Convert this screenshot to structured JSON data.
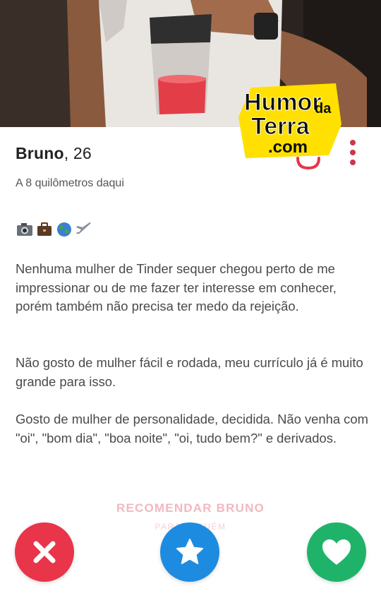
{
  "profile": {
    "name": "Bruno",
    "age": "26",
    "distance": "A 8 quilômetros daqui",
    "emojis": [
      "camera-icon",
      "briefcase-icon",
      "globe-icon",
      "airplane-icon"
    ],
    "bio": [
      "Nenhuma mulher de Tinder sequer chegou perto de me impressionar ou de me fazer ter interesse em conhecer, porém também não precisa ter medo da rejeição.",
      "Não gosto de mulher fácil e rodada, meu currículo já é muito grande para isso.",
      "Gosto de mulher de personalidade, decidida. Não venha com \"oi\", \"bom dia\", \"boa noite\", \"oi, tudo bem?\" e derivados."
    ]
  },
  "watermark": {
    "line1": "Humor",
    "line1_small": "da",
    "line2": "Terra",
    "line3": ".com"
  },
  "recommend": {
    "label": "RECOMENDAR BRUNO",
    "sublabel": "PARA ALGUÉM"
  },
  "actions": {
    "nope_icon": "close-icon",
    "super_icon": "star-icon",
    "like_icon": "heart-icon"
  },
  "colors": {
    "nope": "#e8354a",
    "super": "#1d8ce0",
    "like": "#1fb36a",
    "accent": "#c8394e",
    "recommend": "#f2b8c0"
  }
}
